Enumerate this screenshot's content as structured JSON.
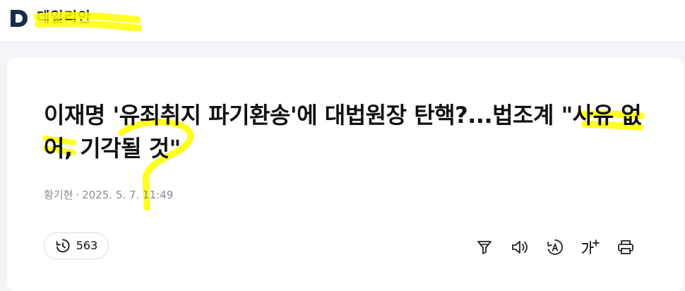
{
  "header": {
    "logo_letter": "D",
    "site_name": "데일리안"
  },
  "article": {
    "title": "이재명 '유죄취지 파기환송'에 대법원장 탄핵?...법조계 \"사유 없어, 기각될 것\"",
    "author": "황기현",
    "separator": "·",
    "published": "2025. 5. 7. 11:49"
  },
  "actions": {
    "comment_count": "563",
    "tools": [
      "filter-icon",
      "speaker-icon",
      "translate-icon",
      "font-size-icon",
      "print-icon"
    ]
  },
  "colors": {
    "brand_dark": "#1b2a4a",
    "highlight": "#ffff00",
    "page_background": "#f3f4f7"
  }
}
